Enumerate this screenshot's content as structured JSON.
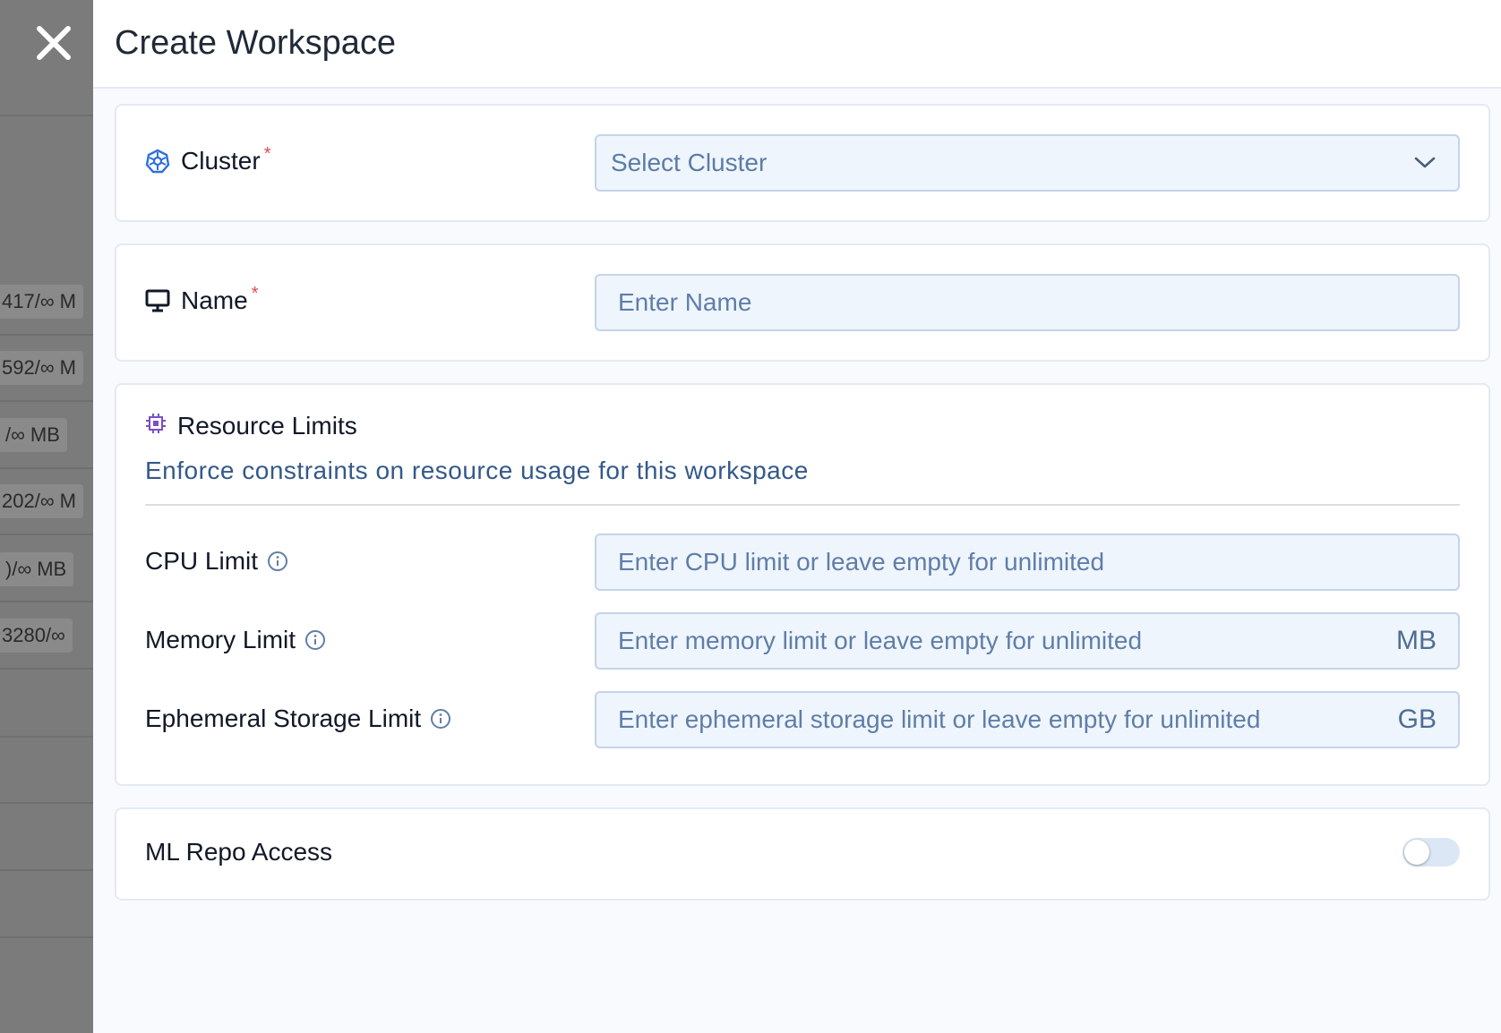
{
  "backdrop": {
    "chips": [
      "417/∞ M",
      "592/∞ M",
      "/∞ MB",
      "202/∞ M",
      ")/∞ MB",
      "3280/∞"
    ]
  },
  "drawer": {
    "title": "Create Workspace",
    "close_icon": "close-icon"
  },
  "cluster": {
    "label": "Cluster",
    "required_mark": "*",
    "placeholder": "Select Cluster",
    "icon": "kubernetes-icon"
  },
  "name": {
    "label": "Name",
    "required_mark": "*",
    "placeholder": "Enter Name",
    "icon": "monitor-icon"
  },
  "resource_limits": {
    "title": "Resource Limits",
    "description": "Enforce constraints on resource usage for this workspace",
    "icon": "chip-icon",
    "cpu": {
      "label": "CPU Limit",
      "placeholder": "Enter CPU limit or leave empty for unlimited"
    },
    "memory": {
      "label": "Memory Limit",
      "placeholder": "Enter memory limit or leave empty for unlimited",
      "unit": "MB"
    },
    "ephemeral": {
      "label": "Ephemeral Storage Limit",
      "placeholder": "Enter ephemeral storage limit or leave empty for unlimited",
      "unit": "GB"
    }
  },
  "ml_repo": {
    "label": "ML Repo Access",
    "enabled": false
  },
  "colors": {
    "accent": "#2f6fdb",
    "required": "#e5484d",
    "chip_icon": "#7c4fc4",
    "field_bg": "#eff5fd",
    "field_border": "#c3d4ea"
  }
}
